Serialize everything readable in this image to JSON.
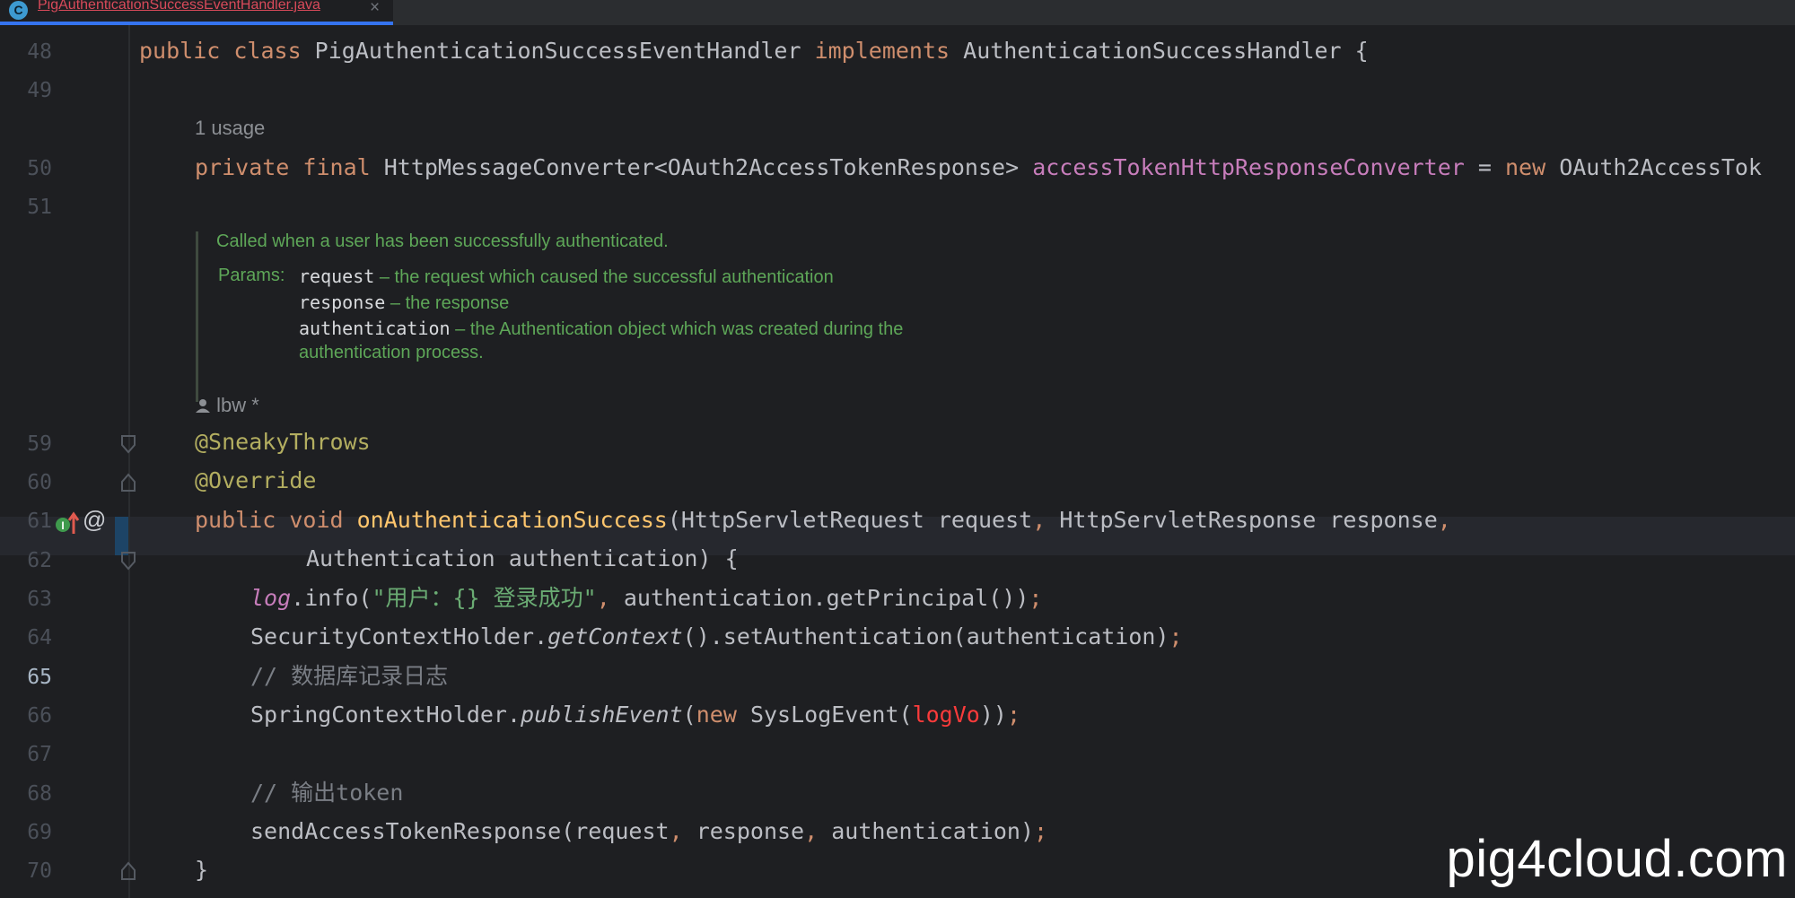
{
  "tab": {
    "icon_letter": "C",
    "title": "PigAuthenticationSuccessEventHandler.java",
    "close_glyph": "×"
  },
  "line_numbers": [
    "48",
    "49",
    "50",
    "51",
    "59",
    "60",
    "61",
    "62",
    "63",
    "64",
    "65",
    "66",
    "67",
    "68",
    "69",
    "70"
  ],
  "active_line": "65",
  "inlays": {
    "usage": "1 usage",
    "author": "lbw *"
  },
  "doc": {
    "summary": "Called when a user has been successfully authenticated.",
    "params_label": "Params:",
    "params": [
      {
        "name": "request",
        "desc": " – the request which caused the successful authentication"
      },
      {
        "name": "response",
        "desc": " – the response"
      },
      {
        "name": "authentication",
        "desc": " – the Authentication object which was created during the"
      }
    ],
    "continuation": "authentication process."
  },
  "code": {
    "l48": {
      "kw1": "public class ",
      "name": "PigAuthenticationSuccessEventHandler ",
      "kw2": "implements ",
      "iface": "AuthenticationSuccessHandler {"
    },
    "l50": {
      "kw": "private final ",
      "type": "HttpMessageConverter<OAuth2AccessTokenResponse> ",
      "field": "accessTokenHttpResponseConverter",
      "eq": " = ",
      "kw2": "new ",
      "rest": "OAuth2AccessTok"
    },
    "l59": {
      "ann": "@SneakyThrows"
    },
    "l60": {
      "ann": "@Override"
    },
    "l61": {
      "kw": "public void ",
      "method": "onAuthenticationSuccess",
      "args": "(HttpServletRequest request",
      "c1": ", ",
      "args2": "HttpServletResponse response",
      "c2": ","
    },
    "l62": {
      "text": "Authentication authentication) {"
    },
    "l63": {
      "log": "log",
      "dot": ".info(",
      "str": "\"用户：{} 登录成功\"",
      "c": ", ",
      "rest": "authentication.getPrincipal())",
      "semi": ";"
    },
    "l64": {
      "a": "SecurityContextHolder.",
      "it": "getContext",
      "b": "().setAuthentication(authentication)",
      "semi": ";"
    },
    "l65": {
      "cmt": "// 数据库记录日志"
    },
    "l66": {
      "a": "SpringContextHolder.",
      "it": "publishEvent",
      "p": "(",
      "kw": "new ",
      "b": "SysLogEvent(",
      "red": "logVo",
      "c": "))",
      "semi": ";"
    },
    "l68": {
      "cmt": "// 输出token"
    },
    "l69": {
      "a": "sendAccessTokenResponse(request",
      "c1": ", ",
      "b": "response",
      "c2": ", ",
      "c": "authentication)",
      "semi": ";"
    },
    "l70": {
      "text": "}"
    }
  },
  "gutter_icons": {
    "implements": "implements-method-icon",
    "at": "@"
  },
  "watermark": "pig4cloud.com",
  "colors": {
    "background": "#1e1f22",
    "keyword": "#cf8e6d",
    "annotation": "#b3ae60",
    "method": "#ffc66d",
    "field": "#c77dbb",
    "string": "#6aab73",
    "doc": "#5ea758",
    "tab_accent": "#3574f0"
  }
}
